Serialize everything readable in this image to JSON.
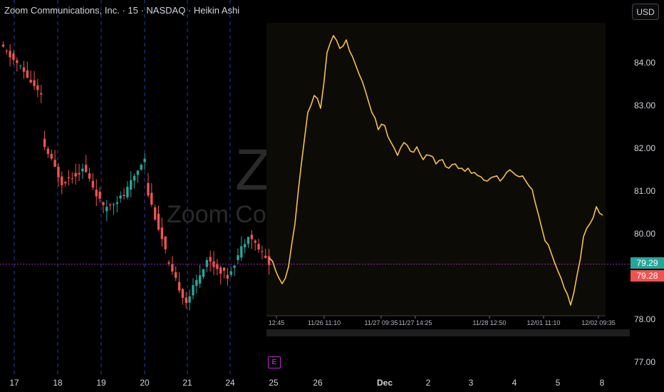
{
  "header": {
    "title": "Zoom Communications, Inc. · 15 · NASDAQ · Heikin Ashi",
    "currency_button": "USD"
  },
  "watermark": {
    "big": "Z",
    "small": "Zoom Co"
  },
  "price_tags": {
    "last_green": "79.29",
    "last_red": "79.28"
  },
  "event_marker": "E",
  "colors": {
    "up": "#26a69a",
    "down": "#ef5350",
    "compare_line": "#f6c148",
    "session_divider": "#2962ff",
    "crosshair": "#9c27b0"
  },
  "chart_data": [
    {
      "type": "candlestick",
      "style": "Heikin Ashi",
      "interval": "15",
      "y_axis": {
        "ticks": [
          "84.00",
          "83.00",
          "82.00",
          "81.00",
          "80.00",
          "79.00",
          "78.00",
          "77.00"
        ],
        "range": [
          76.7,
          84.9
        ]
      },
      "x_axis": {
        "ticks": [
          "17",
          "18",
          "19",
          "20",
          "21",
          "24",
          "25",
          "26",
          "Dec",
          "2",
          "3",
          "4",
          "5",
          "8"
        ]
      },
      "series": [
        {
          "day": "17",
          "open": 84.4,
          "close": 83.9,
          "high": 84.6,
          "low": 83.2
        },
        {
          "day": "17b",
          "open": 83.9,
          "close": 83.2,
          "high": 84.1,
          "low": 82.9
        },
        {
          "day": "18",
          "open": 82.2,
          "close": 81.2,
          "high": 82.4,
          "low": 80.9
        },
        {
          "day": "18b",
          "open": 81.2,
          "close": 81.5,
          "high": 81.7,
          "low": 80.8
        },
        {
          "day": "19",
          "open": 81.6,
          "close": 80.6,
          "high": 81.8,
          "low": 80.4
        },
        {
          "day": "19b",
          "open": 80.6,
          "close": 80.9,
          "high": 81.1,
          "low": 80.4
        },
        {
          "day": "20",
          "open": 80.9,
          "close": 81.8,
          "high": 82.0,
          "low": 80.6
        },
        {
          "day": "20b",
          "open": 81.2,
          "close": 79.6,
          "high": 81.3,
          "low": 79.3
        },
        {
          "day": "21",
          "open": 79.4,
          "close": 78.4,
          "high": 79.6,
          "low": 78.1
        },
        {
          "day": "21b",
          "open": 78.4,
          "close": 79.4,
          "high": 79.7,
          "low": 78.2
        },
        {
          "day": "24",
          "open": 79.4,
          "close": 79.0,
          "high": 79.6,
          "low": 78.6
        },
        {
          "day": "24b",
          "open": 79.0,
          "close": 80.0,
          "high": 80.2,
          "low": 78.9
        },
        {
          "day": "25",
          "open": 80.0,
          "close": 79.3,
          "high": 80.1,
          "low": 78.9
        }
      ]
    },
    {
      "type": "line",
      "x_axis": {
        "ticks": [
          "12:45",
          "11/26 11:10",
          "11/27 09:35",
          "11/27 14:25",
          "11/28 12:50",
          "12/01 11:10",
          "12/02 09:35"
        ]
      },
      "y_range": [
        78.2,
        84.9
      ],
      "values": [
        79.4,
        79.1,
        78.8,
        79.2,
        80.2,
        81.6,
        82.8,
        83.2,
        82.9,
        84.2,
        84.6,
        84.3,
        84.5,
        84.1,
        83.7,
        83.3,
        82.8,
        82.4,
        82.5,
        82.1,
        81.8,
        82.1,
        81.9,
        82.0,
        81.7,
        81.8,
        81.6,
        81.7,
        81.5,
        81.6,
        81.5,
        81.5,
        81.4,
        81.3,
        81.2,
        81.3,
        81.2,
        81.4,
        81.4,
        81.3,
        81.2,
        81.0,
        80.4,
        79.8,
        79.5,
        79.1,
        78.7,
        78.3,
        79.0,
        79.9,
        80.2,
        80.6,
        80.4
      ]
    }
  ]
}
